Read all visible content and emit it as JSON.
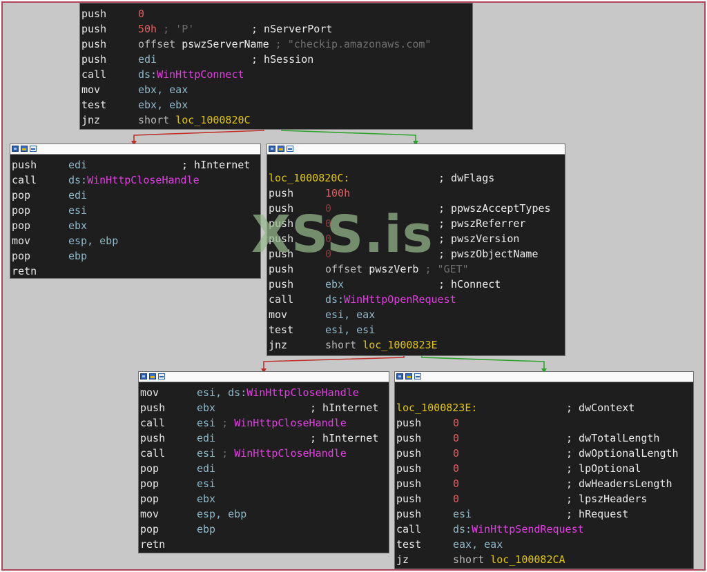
{
  "watermark": "XSS.is",
  "blocks": {
    "b0": {
      "lines": [
        {
          "mn": "push",
          "ops": [
            {
              "t": "0",
              "c": "num"
            }
          ]
        },
        {
          "mn": "push",
          "ops": [
            {
              "t": "50h",
              "c": "num"
            },
            {
              "t": " ; 'P'",
              "c": "rcmt"
            }
          ],
          "cmt": "; nServerPort"
        },
        {
          "mn": "push",
          "ops": [
            {
              "t": "offset ",
              "c": "gray"
            },
            {
              "t": "pswzServerName",
              "c": "white"
            },
            {
              "t": " ; \"checkip.amazonaws.com\"",
              "c": "rcmt"
            }
          ]
        },
        {
          "mn": "push",
          "ops": [
            {
              "t": "edi",
              "c": "reg"
            }
          ],
          "cmt": "; hSession"
        },
        {
          "mn": "call",
          "ops": [
            {
              "t": "ds:",
              "c": "ds"
            },
            {
              "t": "WinHttpConnect",
              "c": "sym"
            }
          ]
        },
        {
          "mn": "mov",
          "ops": [
            {
              "t": "ebx, eax",
              "c": "reg"
            }
          ]
        },
        {
          "mn": "test",
          "ops": [
            {
              "t": "ebx, ebx",
              "c": "reg"
            }
          ]
        },
        {
          "mn": "jnz",
          "ops": [
            {
              "t": "short ",
              "c": "gray"
            },
            {
              "t": "loc_1000820C",
              "c": "loc"
            }
          ]
        }
      ]
    },
    "b1": {
      "lines": [
        {
          "mn": "push",
          "ops": [
            {
              "t": "edi",
              "c": "reg"
            }
          ],
          "cmt": "; hInternet"
        },
        {
          "mn": "call",
          "ops": [
            {
              "t": "ds:",
              "c": "ds"
            },
            {
              "t": "WinHttpCloseHandle",
              "c": "sym"
            }
          ]
        },
        {
          "mn": "pop",
          "ops": [
            {
              "t": "edi",
              "c": "reg"
            }
          ]
        },
        {
          "mn": "pop",
          "ops": [
            {
              "t": "esi",
              "c": "reg"
            }
          ]
        },
        {
          "mn": "pop",
          "ops": [
            {
              "t": "ebx",
              "c": "reg"
            }
          ]
        },
        {
          "mn": "mov",
          "ops": [
            {
              "t": "esp, ebp",
              "c": "reg"
            }
          ]
        },
        {
          "mn": "pop",
          "ops": [
            {
              "t": "ebp",
              "c": "reg"
            }
          ]
        },
        {
          "mn": "retn",
          "ops": []
        }
      ]
    },
    "b2": {
      "lines": [
        {
          "mn": "",
          "ops": []
        },
        {
          "label": "loc_1000820C:",
          "cmt": "; dwFlags"
        },
        {
          "mn": "push",
          "ops": [
            {
              "t": "100h",
              "c": "num"
            }
          ]
        },
        {
          "mn": "push",
          "ops": [
            {
              "t": "0",
              "c": "numdim"
            }
          ],
          "cmt": "; ppwszAcceptTypes"
        },
        {
          "mn": "push",
          "ops": [
            {
              "t": "0",
              "c": "numdim"
            }
          ],
          "cmt": "; pwszReferrer"
        },
        {
          "mn": "push",
          "ops": [
            {
              "t": "0",
              "c": "numdim"
            }
          ],
          "cmt": "; pwszVersion"
        },
        {
          "mn": "push",
          "ops": [
            {
              "t": "0",
              "c": "numdim"
            }
          ],
          "cmt": "; pwszObjectName"
        },
        {
          "mn": "push",
          "ops": [
            {
              "t": "offset ",
              "c": "gray"
            },
            {
              "t": "pwszVerb",
              "c": "white"
            },
            {
              "t": " ; \"GET\"",
              "c": "rcmt"
            }
          ]
        },
        {
          "mn": "push",
          "ops": [
            {
              "t": "ebx",
              "c": "reg"
            }
          ],
          "cmt": "; hConnect"
        },
        {
          "mn": "call",
          "ops": [
            {
              "t": "ds:",
              "c": "ds"
            },
            {
              "t": "WinHttpOpenRequest",
              "c": "sym"
            }
          ]
        },
        {
          "mn": "mov",
          "ops": [
            {
              "t": "esi, eax",
              "c": "reg"
            }
          ]
        },
        {
          "mn": "test",
          "ops": [
            {
              "t": "esi, esi",
              "c": "reg"
            }
          ]
        },
        {
          "mn": "jnz",
          "ops": [
            {
              "t": "short ",
              "c": "gray"
            },
            {
              "t": "loc_1000823E",
              "c": "loc"
            }
          ]
        }
      ]
    },
    "b3": {
      "lines": [
        {
          "mn": "mov",
          "ops": [
            {
              "t": "esi, ",
              "c": "reg"
            },
            {
              "t": "ds:",
              "c": "ds"
            },
            {
              "t": "WinHttpCloseHandle",
              "c": "sym"
            }
          ]
        },
        {
          "mn": "push",
          "ops": [
            {
              "t": "ebx",
              "c": "reg"
            }
          ],
          "cmt": "; hInternet"
        },
        {
          "mn": "call",
          "ops": [
            {
              "t": "esi",
              "c": "reg"
            },
            {
              "t": " ; ",
              "c": "rcmt"
            },
            {
              "t": "WinHttpCloseHandle",
              "c": "sym"
            }
          ]
        },
        {
          "mn": "push",
          "ops": [
            {
              "t": "edi",
              "c": "reg"
            }
          ],
          "cmt": "; hInternet"
        },
        {
          "mn": "call",
          "ops": [
            {
              "t": "esi",
              "c": "reg"
            },
            {
              "t": " ; ",
              "c": "rcmt"
            },
            {
              "t": "WinHttpCloseHandle",
              "c": "sym"
            }
          ]
        },
        {
          "mn": "pop",
          "ops": [
            {
              "t": "edi",
              "c": "reg"
            }
          ]
        },
        {
          "mn": "pop",
          "ops": [
            {
              "t": "esi",
              "c": "reg"
            }
          ]
        },
        {
          "mn": "pop",
          "ops": [
            {
              "t": "ebx",
              "c": "reg"
            }
          ]
        },
        {
          "mn": "mov",
          "ops": [
            {
              "t": "esp, ebp",
              "c": "reg"
            }
          ]
        },
        {
          "mn": "pop",
          "ops": [
            {
              "t": "ebp",
              "c": "reg"
            }
          ]
        },
        {
          "mn": "retn",
          "ops": []
        }
      ]
    },
    "b4": {
      "lines": [
        {
          "label": "loc_1000823E:",
          "cmt": "; dwContext"
        },
        {
          "mn": "push",
          "ops": [
            {
              "t": "0",
              "c": "num"
            }
          ]
        },
        {
          "mn": "push",
          "ops": [
            {
              "t": "0",
              "c": "num"
            }
          ],
          "cmt": "; dwTotalLength"
        },
        {
          "mn": "push",
          "ops": [
            {
              "t": "0",
              "c": "num"
            }
          ],
          "cmt": "; dwOptionalLength"
        },
        {
          "mn": "push",
          "ops": [
            {
              "t": "0",
              "c": "num"
            }
          ],
          "cmt": "; lpOptional"
        },
        {
          "mn": "push",
          "ops": [
            {
              "t": "0",
              "c": "num"
            }
          ],
          "cmt": "; dwHeadersLength"
        },
        {
          "mn": "push",
          "ops": [
            {
              "t": "0",
              "c": "num"
            }
          ],
          "cmt": "; lpszHeaders"
        },
        {
          "mn": "push",
          "ops": [
            {
              "t": "esi",
              "c": "reg"
            }
          ],
          "cmt": "; hRequest"
        },
        {
          "mn": "call",
          "ops": [
            {
              "t": "ds:",
              "c": "ds"
            },
            {
              "t": "WinHttpSendRequest",
              "c": "sym"
            }
          ]
        },
        {
          "mn": "test",
          "ops": [
            {
              "t": "eax, eax",
              "c": "reg"
            }
          ]
        },
        {
          "mn": "jz",
          "ops": [
            {
              "t": "short ",
              "c": "gray"
            },
            {
              "t": "loc_100082CA",
              "c": "loc"
            }
          ]
        }
      ]
    }
  }
}
